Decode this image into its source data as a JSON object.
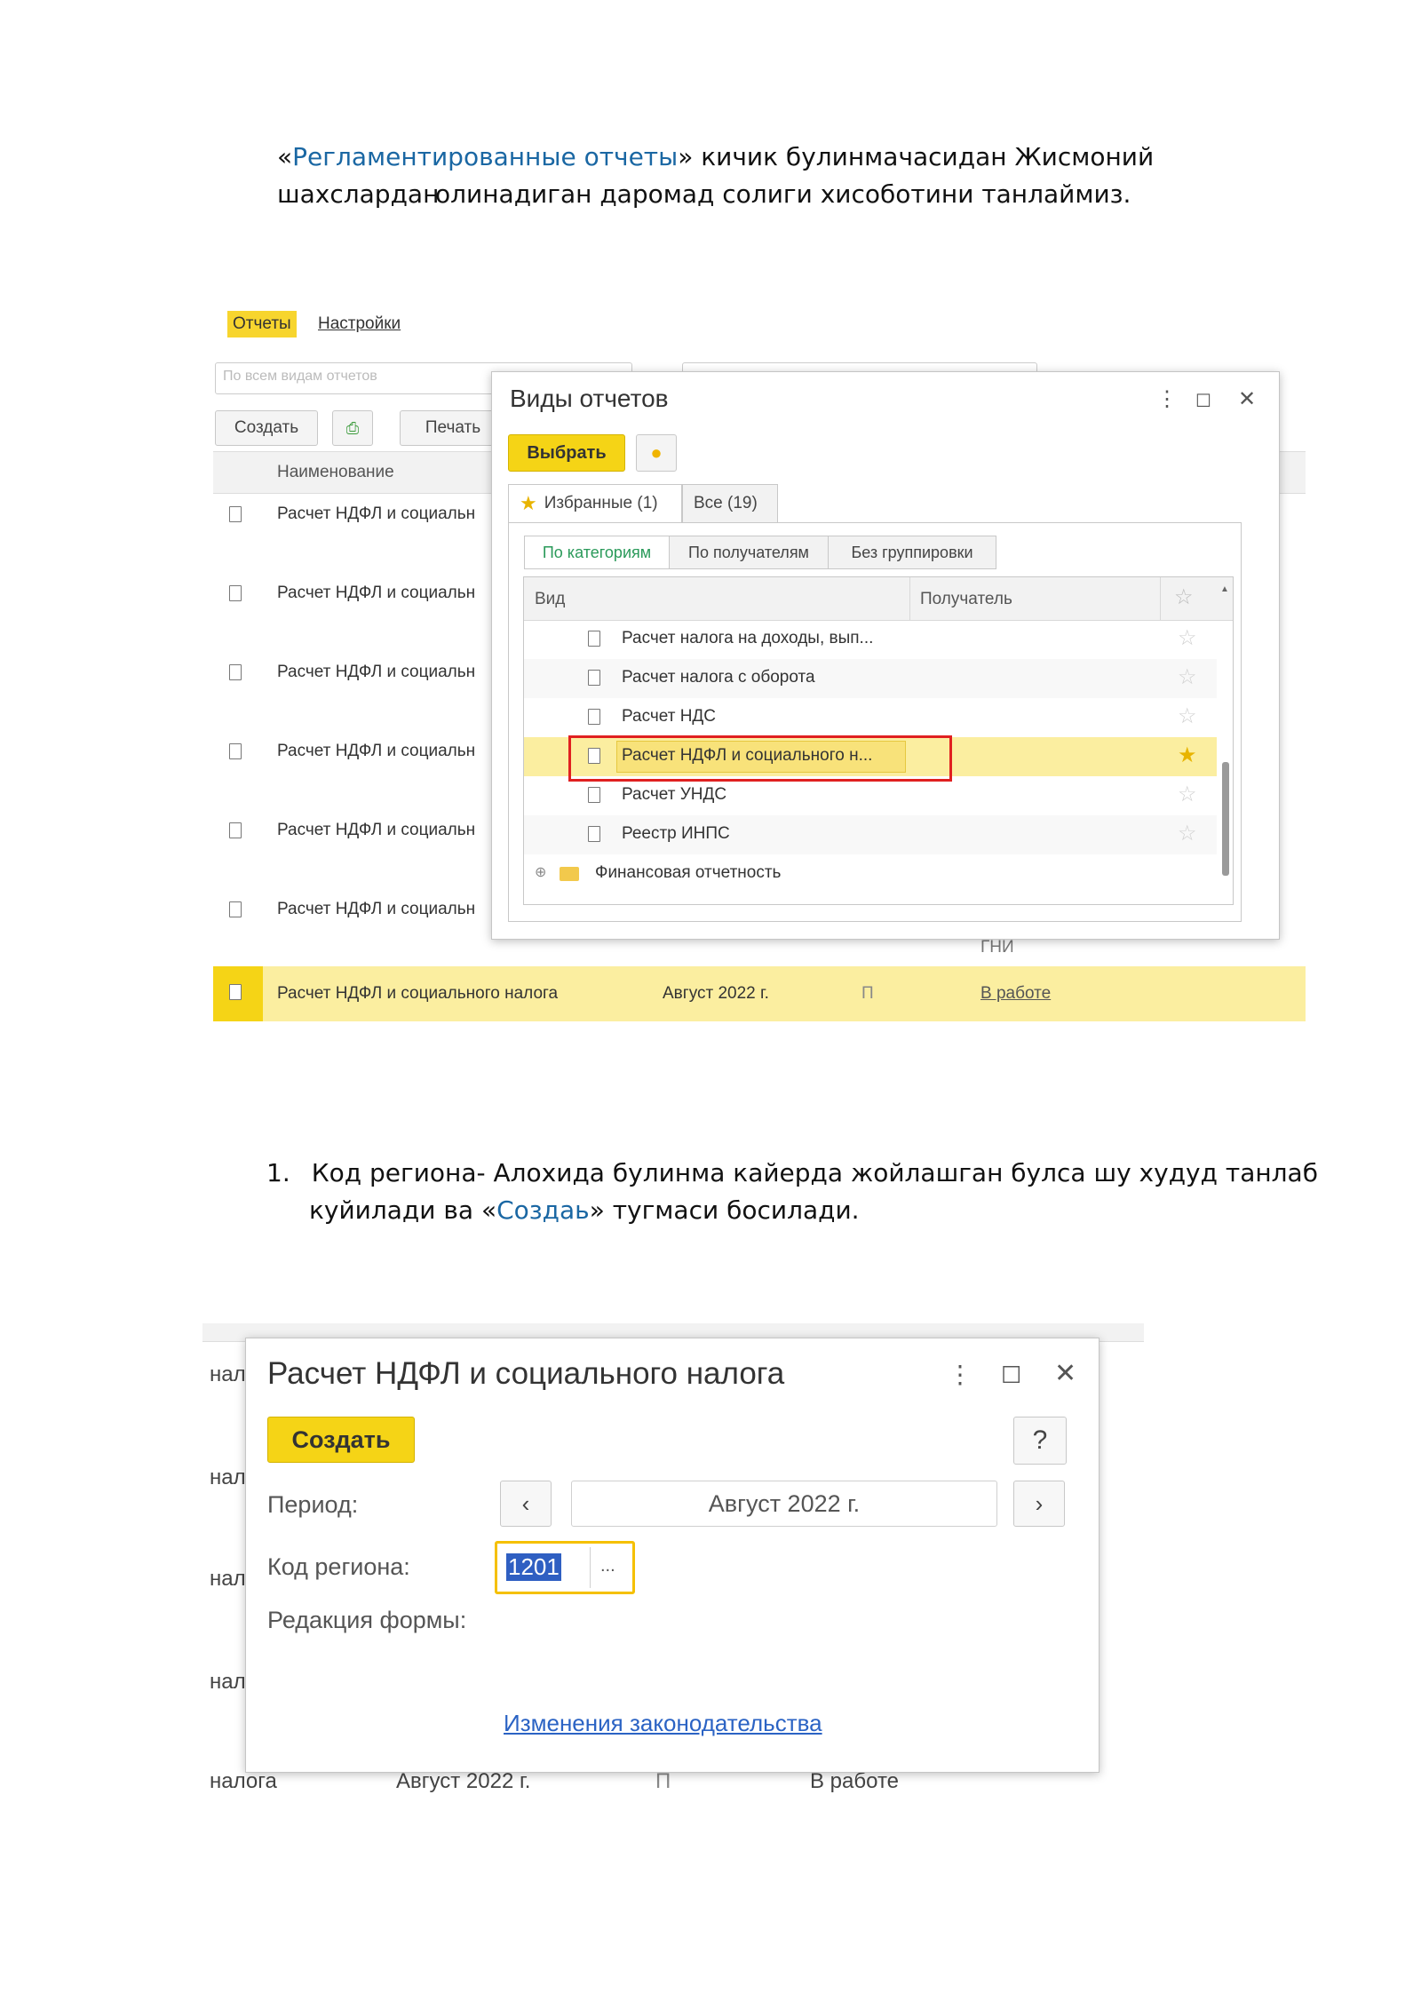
{
  "intro": {
    "q_open": "«",
    "link": "Регламентированные отчеты",
    "rest1": "» кичик булинмачасидан Жисмоний шахслардан",
    "line2": "олинадиган даромад солиги хисоботини танлаймиз."
  },
  "screen1": {
    "top_tabs": [
      "Отчеты",
      "Настройки"
    ],
    "search_placeholder": "По всем видам отчетов",
    "toolbar": {
      "create": "Создать",
      "print": "Печать"
    },
    "list_header": "Наименование",
    "list_rows": [
      "Расчет НДФЛ и социальн",
      "Расчет НДФЛ и социальн",
      "Расчет НДФЛ и социальн",
      "Расчет НДФЛ и социальн",
      "Расчет НДФЛ и социальн",
      "Расчет НДФЛ и социальн"
    ],
    "bottom_row": {
      "name": "Расчет НДФЛ и социального налога",
      "period": "Август 2022 г.",
      "mark": "П",
      "status": "В работе",
      "above": "ГНИ"
    },
    "dialog": {
      "title": "Виды отчетов",
      "select_btn": "Выбрать",
      "tabs": [
        "Избранные (1)",
        "Все (19)"
      ],
      "groupings": [
        "По категориям",
        "По получателям",
        "Без группировки"
      ],
      "columns": [
        "Вид",
        "Получатель"
      ],
      "rows": [
        {
          "name": "Расчет налога на доходы, вып...",
          "fav": false
        },
        {
          "name": "Расчет налога с оборота",
          "fav": false
        },
        {
          "name": "Расчет НДС",
          "fav": false
        },
        {
          "name": "Расчет НДФЛ и социального н...",
          "fav": true
        },
        {
          "name": "Расчет УНДС",
          "fav": false
        },
        {
          "name": "Реестр ИНПС",
          "fav": false
        }
      ],
      "folder": "Финансовая отчетность"
    }
  },
  "step1": {
    "num": "1.",
    "line1": "Код региона- Алохида булинма кайерда жойлашган булса шу худуд танлаб",
    "line2_pre": "куйилади ва «",
    "line2_link": "Создаь",
    "line2_post": "» тугмаси босилади."
  },
  "screen2": {
    "bg_left": [
      "нал",
      "нал",
      "нал",
      "нал"
    ],
    "bg_bottom": {
      "name": "налога",
      "period": "Август 2022 г.",
      "mark": "П",
      "status": "В работе"
    },
    "title": "Расчет НДФЛ и социального налога",
    "create_btn": "Создать",
    "help_btn": "?",
    "period_label": "Период:",
    "period_value": "Август 2022 г.",
    "region_label": "Код региона:",
    "region_value": "1201",
    "region_more": "...",
    "form_label": "Редакция формы:",
    "law_link": "Изменения законодательства"
  }
}
